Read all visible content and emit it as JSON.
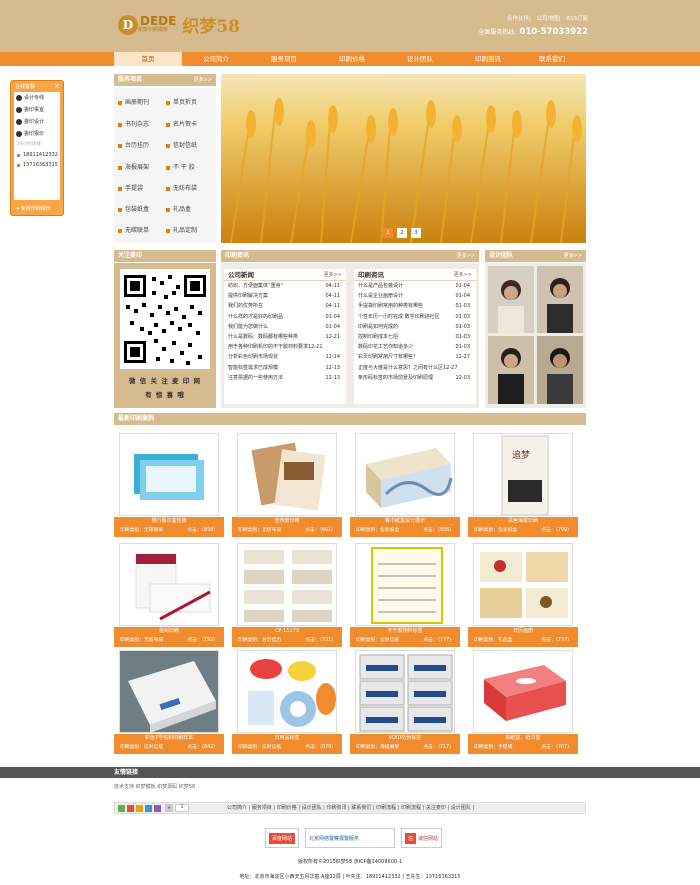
{
  "header": {
    "logo_mark": "D",
    "logo_word": "DEDE",
    "logo_sub": "织梦印刷模板",
    "logo_cn": "织梦58",
    "top_links": [
      "合作伙伴",
      "公司地图",
      "RSS订阅"
    ],
    "hotline_label": "全国服务热线:",
    "hotline_number": "010-57033922"
  },
  "nav": [
    "首页",
    "公司简介",
    "服务项目",
    "印刷价格",
    "设计团队",
    "印刷资讯",
    "联系我们"
  ],
  "float_service": {
    "title": "在线客服",
    "qq": [
      "设计专线",
      "委印事宜",
      "委印设计",
      "委印报价"
    ],
    "phone_label": "24小时热线",
    "phones": [
      "18911412332",
      "13716363315"
    ],
    "footer": "免费印刷报价"
  },
  "services": {
    "title": "服务项目",
    "more": "更多>>",
    "items": [
      "画册期刊",
      "单页折页",
      "书刊杂志",
      "名片贺卡",
      "台历挂历",
      "信封信纸",
      "海报展架",
      "不 干 胶",
      "手提袋",
      "无纺布袋",
      "包装纸盒",
      "礼品盒",
      "无碳联单",
      "礼品定制"
    ]
  },
  "banner": {
    "slides": [
      "1",
      "2",
      "3"
    ],
    "active": 0
  },
  "follow": {
    "title": "关注麦印",
    "line1": "微 信 关 注 麦 印 网",
    "line2": "有 惊 喜 哦"
  },
  "print_news": {
    "title": "印刷资讯",
    "more": "更多>>"
  },
  "company_news": {
    "title": "公司新闻",
    "more": "更多>>",
    "items": [
      {
        "t": "纺织、方便面集体“重身”",
        "d": "04-11"
      },
      {
        "t": "提供印刷解决方案",
        "d": "04-11"
      },
      {
        "t": "我们的优势所在",
        "d": "04-11"
      },
      {
        "t": "什么样的才是好的印刷品",
        "d": "01-04"
      },
      {
        "t": "我们能为您做什么",
        "d": "01-04"
      },
      {
        "t": "什么是数码：数码都有哪些种类",
        "d": "12-21"
      },
      {
        "t": "用于各种印刷机印的不干胶材料要求12-21",
        "d": ""
      },
      {
        "t": "分析彩色印刷市场现状",
        "d": "12-14"
      },
      {
        "t": "智能标签需求已成规模",
        "d": "12-13"
      },
      {
        "t": "注意票据的一些使用方法",
        "d": "12-13"
      }
    ]
  },
  "industry_news": {
    "title": "印刷资讯",
    "more": "更多>>",
    "items": [
      {
        "t": "什么是产品包装设计",
        "d": "01-04"
      },
      {
        "t": "什么是企业画册设计",
        "d": "01-04"
      },
      {
        "t": "手提袋印刷常用的种类有哪些",
        "d": "01-03"
      },
      {
        "t": "个性年历一小时完成 数字印刷进社区",
        "d": "01-03"
      },
      {
        "t": "印刷是如何完成的",
        "d": "01-03"
      },
      {
        "t": "控制印刷成本七招",
        "d": "01-03"
      },
      {
        "t": "数码印花工艺你知道多少",
        "d": "01-03"
      },
      {
        "t": "彩页印刷常用尺寸有哪些？",
        "d": "12-27"
      },
      {
        "t": "正度与大度是什么意思？之间有什么区12-27",
        "d": ""
      },
      {
        "t": "条形码标签的市场前景及印刷原理",
        "d": "12-03"
      }
    ]
  },
  "team": {
    "title": "设计团队",
    "more": "更多>>"
  },
  "cases": {
    "title": "最新印刷案例",
    "items": [
      {
        "title": "银行餐巾盒包装",
        "type": "印刷类别：无碳联单",
        "clicks": "点击：（858）"
      },
      {
        "title": "宣传册印刷",
        "type": "印刷类别：无纺布袋",
        "clicks": "点击：（661）"
      },
      {
        "title": "餐巾纸盒设计展示",
        "type": "印刷类别：包装纸盒",
        "clicks": "点击：（808）"
      },
      {
        "title": "清宫海报印刷",
        "type": "印刷类别：包装纸盒",
        "clicks": "点击：（799）"
      },
      {
        "title": "信封印刷",
        "type": "印刷类别：无纺布袋",
        "clicks": "点击：（792）"
      },
      {
        "title": "CP-11173",
        "type": "印刷类别：台历挂历",
        "clicks": "点击：（731）"
      },
      {
        "title": "不干胶物料标签",
        "type": "印刷类别：信封信纸",
        "clicks": "点击：（777）"
      },
      {
        "title": "日历画册",
        "type": "印刷类别：礼品盒",
        "clicks": "点击：（737）"
      },
      {
        "title": "彩色7号信封印刷样本",
        "type": "印刷类别：信封信纸",
        "clicks": "点击：（842）"
      },
      {
        "title": "日用品标签",
        "type": "印刷类别：信封信纸",
        "clicks": "点击：（879）"
      },
      {
        "title": "VOID防伪标签",
        "type": "印刷类别：海报展架",
        "clicks": "点击：（717）"
      },
      {
        "title": "抽纸盒、纸巾盒",
        "type": "印刷类别：手提袋",
        "clicks": "点击：（707）"
      }
    ]
  },
  "friend_links": {
    "title": "友情链接",
    "items": "技术支持 织梦模板 织梦源码 织梦58"
  },
  "footer_nav": {
    "count": "1",
    "items": "公司简介 | 服务项目 | 印刷价格 | 设计团队 | 印刷资讯 | 联系我们 | 印刷流程 | 印刷流程 | 关注麦印 | 设计团队 |"
  },
  "badges": [
    "百度网站",
    "北京网络警察报警服务",
    "诚信网站"
  ],
  "copyright": "版权所有©2015织梦58  京ICP备14008600-1",
  "address": "地址：北京市海淀区小西天五月华庭 A座12层  |  叶先生：18911412332  |  王先生：13716363315"
}
